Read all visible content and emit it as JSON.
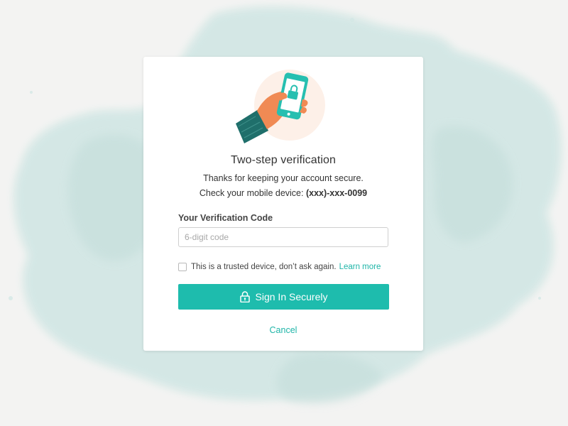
{
  "dialog": {
    "title": "Two-step verification",
    "subtitle": "Thanks for keeping your account secure.",
    "device_prefix": "Check your mobile device: ",
    "device_number": "(xxx)-xxx-0099"
  },
  "form": {
    "code_label": "Your Verification Code",
    "code_placeholder": "6-digit code",
    "code_value": "",
    "trusted_label": "This is a trusted device, don’t ask again.",
    "trusted_checked": false,
    "learn_more": "Learn more",
    "submit_label": "Sign In Securely",
    "cancel_label": "Cancel"
  },
  "icons": {
    "illustration": "hand-holding-phone-lock",
    "button_icon": "padlock-icon"
  },
  "colors": {
    "accent": "#1ebcad",
    "link": "#1fb5a8",
    "background": "#f3f3f2",
    "wash": "#d3e7e5",
    "hand": "#f08a54",
    "sleeve": "#1f6f6b"
  }
}
